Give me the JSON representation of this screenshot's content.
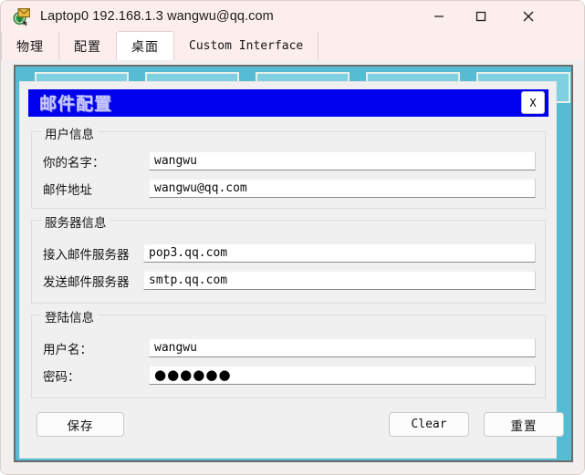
{
  "window": {
    "icon": "mail-envelope-icon",
    "title": "Laptop0 192.168.1.3 wangwu@qq.com",
    "controls": {
      "minimize": "minimize-icon",
      "maximize": "maximize-icon",
      "close": "close-icon"
    }
  },
  "tabs": [
    {
      "label": "物理",
      "active": false
    },
    {
      "label": "配置",
      "active": false
    },
    {
      "label": "桌面",
      "active": true
    },
    {
      "label": "Custom Interface",
      "active": false
    }
  ],
  "dialog": {
    "title": "邮件配置",
    "close_label": "X",
    "title_bar_color": "#0000EE",
    "groups": [
      {
        "name": "user-info",
        "title": "用户信息",
        "fields": [
          {
            "name": "your-name",
            "label": "你的名字：",
            "value": "wangwu",
            "placeholder": ""
          },
          {
            "name": "email-address",
            "label": "邮件地址",
            "value": "wangwu@qq.com",
            "placeholder": ""
          }
        ]
      },
      {
        "name": "server-info",
        "title": "服务器信息",
        "fields": [
          {
            "name": "incoming-mail-server",
            "label": "接入邮件服务器",
            "value": "pop3.qq.com",
            "placeholder": ""
          },
          {
            "name": "outgoing-mail-server",
            "label": "发送邮件服务器",
            "value": "smtp.qq.com",
            "placeholder": ""
          }
        ]
      },
      {
        "name": "login-info",
        "title": "登陆信息",
        "fields": [
          {
            "name": "username",
            "label": "用户名：",
            "value": "wangwu",
            "placeholder": ""
          },
          {
            "name": "password",
            "label": "密码：",
            "value": "●●●●●●",
            "placeholder": ""
          }
        ]
      }
    ],
    "buttons": {
      "save": "保存",
      "clear": "Clear",
      "reset": "重置"
    }
  },
  "desktop": {
    "background_color": "#55BCD4",
    "icon_tiles": 5
  }
}
